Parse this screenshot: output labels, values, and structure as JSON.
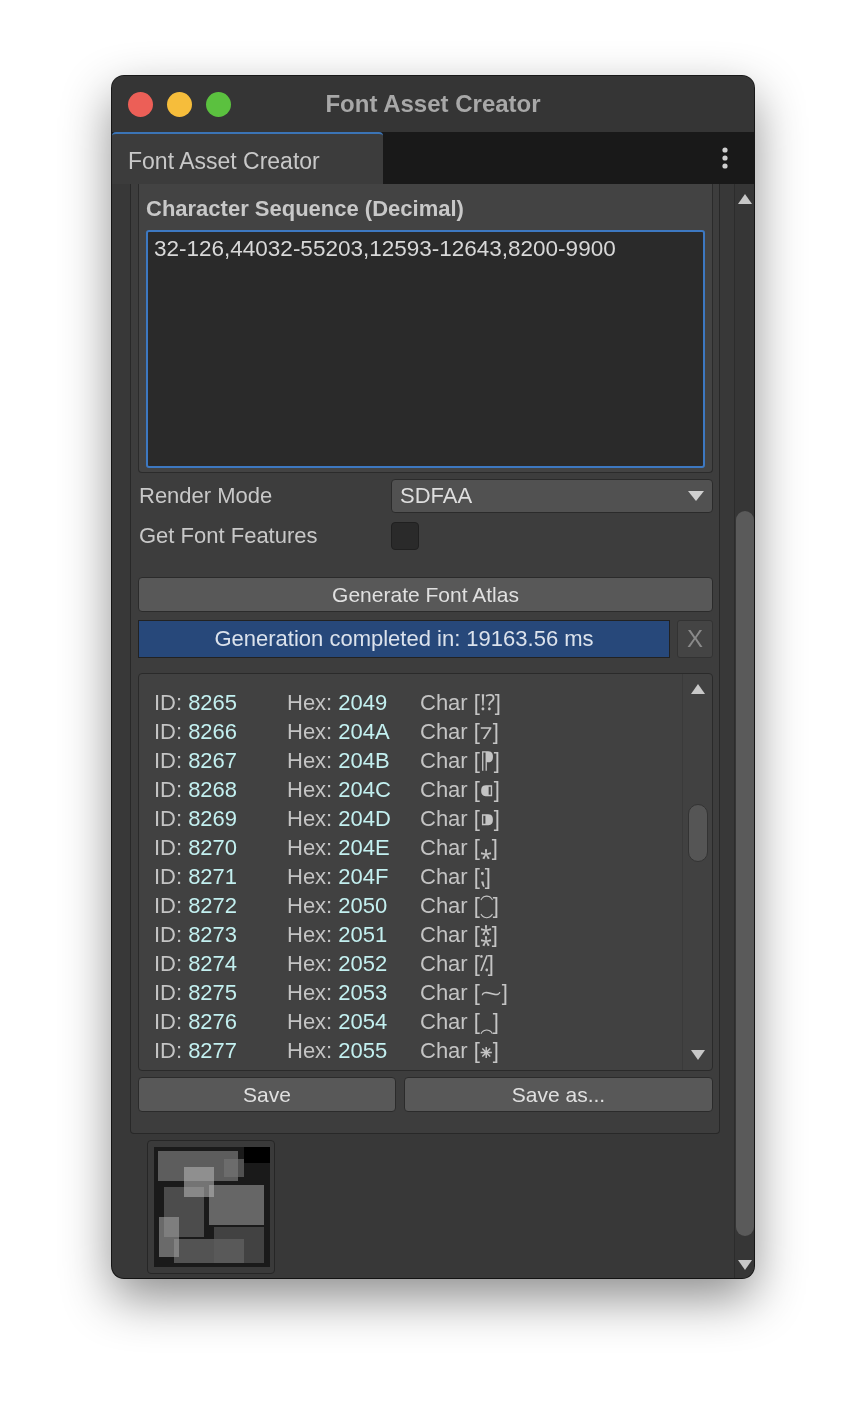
{
  "window": {
    "title": "Font Asset Creator",
    "controls": [
      {
        "color": "#ec5f57"
      },
      {
        "color": "#f6bd3b"
      },
      {
        "color": "#5bc13f"
      }
    ]
  },
  "tabs": [
    {
      "label": "Font Asset Creator",
      "selected": true
    }
  ],
  "character_sequence": {
    "label": "Character Sequence (Decimal)",
    "value": "32-126,44032-55203,12593-12643,8200-9900",
    "focused": true
  },
  "render_mode": {
    "label": "Render Mode",
    "value": "SDFAA"
  },
  "get_font_features": {
    "label": "Get Font Features",
    "checked": false
  },
  "generate_button": "Generate Font Atlas",
  "progress": {
    "text": "Generation completed in: 19163.56 ms",
    "level": 1
  },
  "cancel_button": "X",
  "glyphs": [
    {
      "id_label": "ID:",
      "id": "8265",
      "hex_label": "Hex:",
      "hex": "2049",
      "char_label": "Char",
      "char": "[⁉]"
    },
    {
      "id_label": "ID:",
      "id": "8266",
      "hex_label": "Hex:",
      "hex": "204A",
      "char_label": "Char",
      "char": "[⁊]"
    },
    {
      "id_label": "ID:",
      "id": "8267",
      "hex_label": "Hex:",
      "hex": "204B",
      "char_label": "Char",
      "char": "[⁋]"
    },
    {
      "id_label": "ID:",
      "id": "8268",
      "hex_label": "Hex:",
      "hex": "204C",
      "char_label": "Char",
      "char": "[⁌]"
    },
    {
      "id_label": "ID:",
      "id": "8269",
      "hex_label": "Hex:",
      "hex": "204D",
      "char_label": "Char",
      "char": "[⁍]"
    },
    {
      "id_label": "ID:",
      "id": "8270",
      "hex_label": "Hex:",
      "hex": "204E",
      "char_label": "Char",
      "char": "[⁎]"
    },
    {
      "id_label": "ID:",
      "id": "8271",
      "hex_label": "Hex:",
      "hex": "204F",
      "char_label": "Char",
      "char": "[⁏]"
    },
    {
      "id_label": "ID:",
      "id": "8272",
      "hex_label": "Hex:",
      "hex": "2050",
      "char_label": "Char",
      "char": "[⁐]"
    },
    {
      "id_label": "ID:",
      "id": "8273",
      "hex_label": "Hex:",
      "hex": "2051",
      "char_label": "Char",
      "char": "[⁑]"
    },
    {
      "id_label": "ID:",
      "id": "8274",
      "hex_label": "Hex:",
      "hex": "2052",
      "char_label": "Char",
      "char": "[⁒]"
    },
    {
      "id_label": "ID:",
      "id": "8275",
      "hex_label": "Hex:",
      "hex": "2053",
      "char_label": "Char",
      "char": "[⁓]"
    },
    {
      "id_label": "ID:",
      "id": "8276",
      "hex_label": "Hex:",
      "hex": "2054",
      "char_label": "Char",
      "char": "[⁔]"
    },
    {
      "id_label": "ID:",
      "id": "8277",
      "hex_label": "Hex:",
      "hex": "2055",
      "char_label": "Char",
      "char": "[⁕]"
    }
  ],
  "save_buttons": [
    "Save",
    "Save as..."
  ],
  "atlas_preview": {
    "kind": "picture"
  }
}
